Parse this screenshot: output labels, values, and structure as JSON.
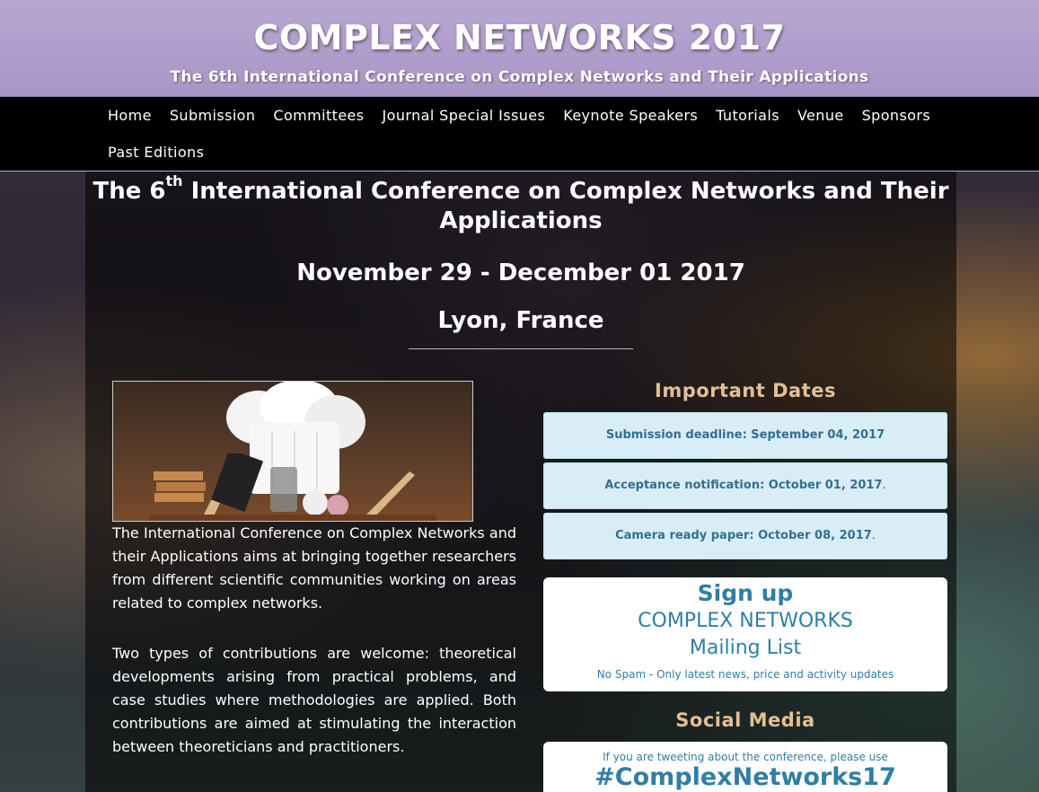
{
  "header": {
    "title": "COMPLEX NETWORKS 2017",
    "subtitle": "The 6th International Conference on Complex Networks and Their Applications"
  },
  "nav": {
    "items": [
      {
        "label": "Home"
      },
      {
        "label": "Submission"
      },
      {
        "label": "Committees"
      },
      {
        "label": "Journal Special Issues"
      },
      {
        "label": "Keynote Speakers"
      },
      {
        "label": "Tutorials"
      },
      {
        "label": "Venue"
      },
      {
        "label": "Sponsors"
      },
      {
        "label": "Past Editions"
      }
    ]
  },
  "hero": {
    "title_prefix": "The 6",
    "title_sup": "th",
    "title_rest": " International Conference on Complex Networks and Their Applications",
    "dates": "November 29 - December 01 2017",
    "location": "Lyon, France"
  },
  "about": {
    "p1": "The International Conference on Complex Networks and their Applications aims at bringing together researchers from different scientific communities working on areas related to complex networks.",
    "p2": "Two types of contributions are welcome: theoretical developments arising from practical problems, and case studies where methodologies are applied. Both contributions are aimed at stimulating the interaction between theoreticians and practitioners."
  },
  "important_dates": {
    "heading": "Important Dates",
    "items": [
      {
        "text": "Submission deadline: September 04, 2017",
        "suffix": ""
      },
      {
        "text": "Acceptance notification: October 01, 2017",
        "suffix": "."
      },
      {
        "text": "Camera ready paper: October 08, 2017",
        "suffix": "."
      }
    ]
  },
  "signup": {
    "title": "Sign up",
    "line2": "COMPLEX NETWORKS",
    "line3": "Mailing List",
    "note": "No Spam - Only latest news, price and activity updates"
  },
  "social": {
    "heading": "Social Media",
    "note": "If you are tweeting about the conference, please use",
    "hashtag": "#ComplexNetworks17"
  },
  "colors": {
    "header_bg": "#ab98c8",
    "nav_bg": "#000000",
    "heading_accent": "#e4bf95",
    "info_bg": "#d9edf7",
    "info_text": "#31708f",
    "link_blue": "#2f7fa5"
  }
}
